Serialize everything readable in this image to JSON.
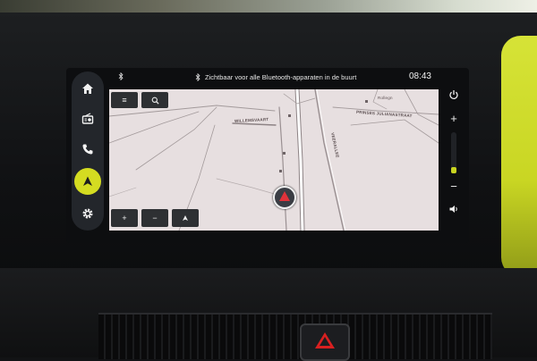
{
  "status_bar": {
    "bluetooth_icon": "bluetooth-icon",
    "message": "Zichtbaar voor alle Bluetooth-apparaten in de buurt",
    "time": "08:43"
  },
  "left_rail": {
    "items": [
      {
        "name": "home",
        "icon": "home-icon",
        "active": false
      },
      {
        "name": "radio",
        "icon": "radio-icon",
        "active": false
      },
      {
        "name": "phone",
        "icon": "phone-icon",
        "active": false
      },
      {
        "name": "navigation",
        "icon": "navigation-icon",
        "active": true
      },
      {
        "name": "settings",
        "icon": "gear-icon",
        "active": false
      }
    ]
  },
  "map": {
    "menu_label": "≡",
    "search_icon": "search-icon",
    "zoom_in_label": "+",
    "zoom_out_label": "−",
    "compass_icon": "compass-icon",
    "streets": [
      {
        "label": "WILLEMSVAART"
      },
      {
        "label": "PRINSES JULIANASTRAAT"
      },
      {
        "label": "VEERALLEE"
      },
      {
        "label": "Rollegn"
      }
    ],
    "colors": {
      "background": "#e7dfe0",
      "road": "#ffffff",
      "road_edge": "#8d8385"
    }
  },
  "right_rail": {
    "power_icon": "power-icon",
    "volume_up_label": "+",
    "volume_down_label": "−",
    "speaker_icon": "speaker-icon",
    "volume_level": 0.15
  },
  "colors": {
    "accent": "#d4dc21",
    "rail": "#23262b",
    "screen": "#0d0e10"
  }
}
